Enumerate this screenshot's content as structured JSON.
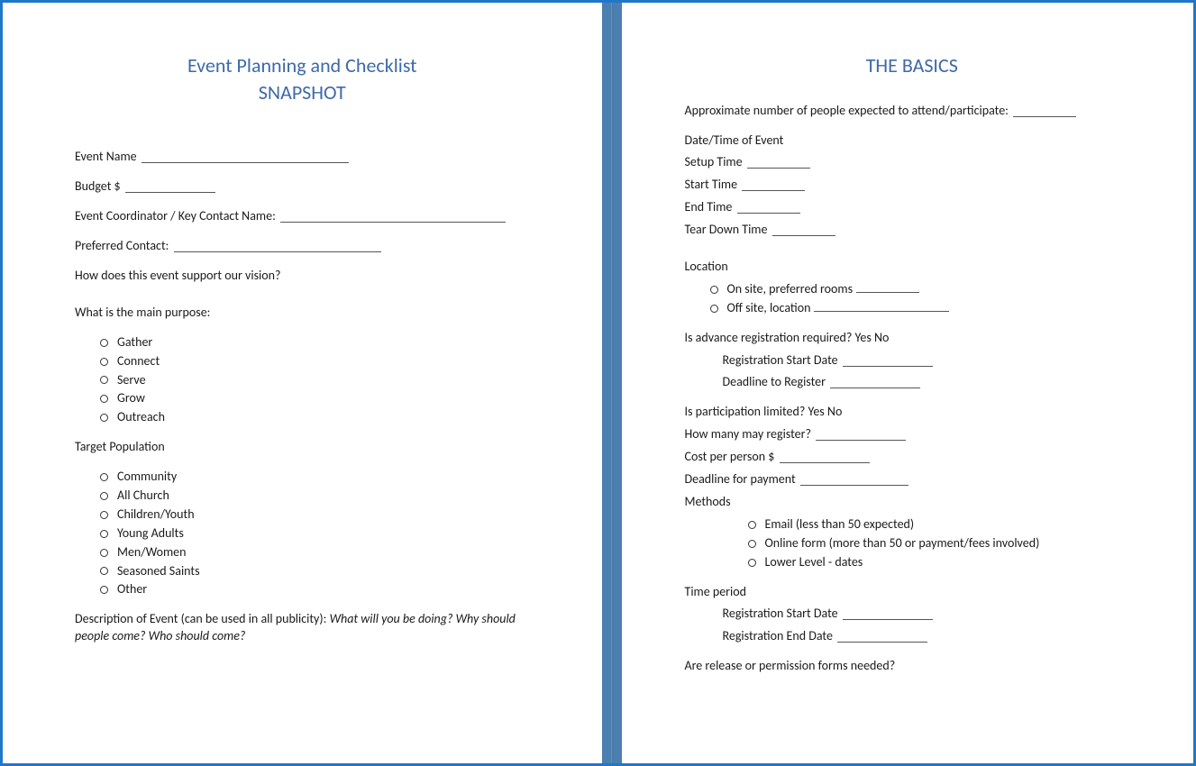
{
  "left": {
    "title_line1": "Event Planning and Checklist",
    "title_line2": "SNAPSHOT",
    "event_name_label": "Event Name",
    "budget_label": "Budget $",
    "coordinator_label": "Event Coordinator / Key Contact Name:",
    "preferred_contact_label": "Preferred Contact:",
    "vision_label": "How does this event support our vision?",
    "purpose_label": "What is the main purpose:",
    "purpose_options": [
      "Gather",
      "Connect",
      "Serve",
      "Grow",
      "Outreach"
    ],
    "target_label": "Target Population",
    "target_options": [
      "Community",
      "All Church",
      "Children/Youth",
      "Young Adults",
      "Men/Women",
      "Seasoned Saints",
      "Other"
    ],
    "description_label": "Description of Event (can be used in all publicity):",
    "description_italic": "What will you be doing? Why should people come? Who should come?"
  },
  "right": {
    "title": "THE BASICS",
    "attendance_label": "Approximate number of people expected to attend/participate:",
    "datetime_label": "Date/Time of Event",
    "setup_label": "Setup Time",
    "start_label": "Start Time",
    "end_label": "End Time",
    "teardown_label": "Tear Down Time",
    "location_label": "Location",
    "location_options": {
      "onsite": "On site, preferred rooms",
      "offsite": "Off site, location"
    },
    "advance_reg_label": "Is advance registration required? Yes No",
    "reg_start_label": "Registration Start Date",
    "reg_deadline_label": "Deadline to Register",
    "participation_limited_label": "Is participation limited? Yes No",
    "how_many_label": "How many may register?",
    "cost_label": "Cost per person $",
    "payment_deadline_label": "Deadline for payment",
    "methods_label": "Methods",
    "methods_options": [
      "Email (less than 50 expected)",
      "Online form (more than 50 or payment/fees involved)",
      "Lower Level - dates"
    ],
    "time_period_label": "Time period",
    "tp_reg_start_label": "Registration Start Date",
    "tp_reg_end_label": "Registration End Date",
    "release_label": "Are release or permission forms needed?"
  }
}
